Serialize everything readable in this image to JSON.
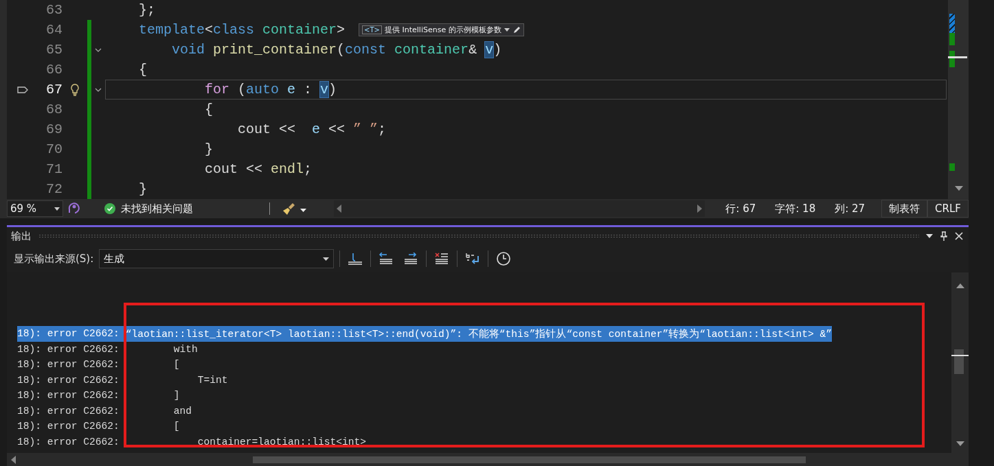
{
  "editor": {
    "lines": [
      {
        "number": "63",
        "current": false,
        "changed": false,
        "fold": false,
        "tokens": [
          {
            "text": "    };",
            "kind": "plain"
          }
        ]
      },
      {
        "number": "64",
        "current": false,
        "changed": true,
        "fold": false,
        "tokens": [
          {
            "text": "    template",
            "kind": "keyword"
          },
          {
            "text": "<",
            "kind": "plain"
          },
          {
            "text": "class",
            "kind": "keyword"
          },
          {
            "text": " container",
            "kind": "type"
          },
          {
            "text": ">",
            "kind": "plain"
          }
        ],
        "hint": {
          "badge": "<T>",
          "text": "提供 IntelliSense 的示例模板参数"
        }
      },
      {
        "number": "65",
        "current": false,
        "changed": true,
        "fold": true,
        "tokens": [
          {
            "text": "        void",
            "kind": "keyword"
          },
          {
            "text": " print_container",
            "kind": "function"
          },
          {
            "text": "(",
            "kind": "plain"
          },
          {
            "text": "const",
            "kind": "keyword"
          },
          {
            "text": " container",
            "kind": "type"
          },
          {
            "text": "& ",
            "kind": "plain"
          },
          {
            "text": "v",
            "kind": "highlight"
          },
          {
            "text": ")",
            "kind": "plain"
          }
        ]
      },
      {
        "number": "66",
        "current": false,
        "changed": true,
        "fold": false,
        "tokens": [
          {
            "text": "    {",
            "kind": "plain"
          }
        ]
      },
      {
        "number": "67",
        "current": true,
        "changed": true,
        "fold": true,
        "tokens": [
          {
            "text": "            for",
            "kind": "control"
          },
          {
            "text": " (",
            "kind": "plain"
          },
          {
            "text": "auto",
            "kind": "keyword"
          },
          {
            "text": " e",
            "kind": "variable"
          },
          {
            "text": " : ",
            "kind": "plain"
          },
          {
            "text": "v",
            "kind": "highlight"
          },
          {
            "text": ")",
            "kind": "plain"
          }
        ]
      },
      {
        "number": "68",
        "current": false,
        "changed": true,
        "fold": false,
        "tokens": [
          {
            "text": "            {",
            "kind": "plain"
          }
        ]
      },
      {
        "number": "69",
        "current": false,
        "changed": true,
        "fold": false,
        "tokens": [
          {
            "text": "                cout <<  ",
            "kind": "plain"
          },
          {
            "text": "e",
            "kind": "variable"
          },
          {
            "text": " << ",
            "kind": "plain"
          },
          {
            "text": "” ”",
            "kind": "string"
          },
          {
            "text": ";",
            "kind": "plain"
          }
        ]
      },
      {
        "number": "70",
        "current": false,
        "changed": true,
        "fold": false,
        "tokens": [
          {
            "text": "            }",
            "kind": "plain"
          }
        ]
      },
      {
        "number": "71",
        "current": false,
        "changed": true,
        "fold": false,
        "tokens": [
          {
            "text": "            cout << ",
            "kind": "plain"
          },
          {
            "text": "endl",
            "kind": "function"
          },
          {
            "text": ";",
            "kind": "plain"
          }
        ]
      },
      {
        "number": "72",
        "current": false,
        "changed": true,
        "fold": false,
        "tokens": [
          {
            "text": "    }",
            "kind": "plain"
          }
        ]
      }
    ]
  },
  "status_bar": {
    "zoom": "69 %",
    "issues": "未找到相关问题",
    "position": [
      "行: 67",
      "字符: 18",
      "列: 27"
    ],
    "indent": "制表符",
    "line_ending": "CRLF"
  },
  "output": {
    "title": "输出",
    "source_label": "显示输出来源(S):",
    "source": "生成",
    "rows": [
      {
        "prefix": "18): error C2662:",
        "message": "“laotian::list_iterator<T> laotian::list<T>::end(void)”: 不能将“this”指针从“const container”转换为“laotian::list<int> &”",
        "selected": true
      },
      {
        "prefix": "18): error C2662:",
        "message": "        with",
        "selected": false
      },
      {
        "prefix": "18): error C2662:",
        "message": "        [",
        "selected": false
      },
      {
        "prefix": "18): error C2662:",
        "message": "            T=int",
        "selected": false
      },
      {
        "prefix": "18): error C2662:",
        "message": "        ]",
        "selected": false
      },
      {
        "prefix": "18): error C2662:",
        "message": "        and",
        "selected": false
      },
      {
        "prefix": "18): error C2662:",
        "message": "        [",
        "selected": false
      },
      {
        "prefix": "18): error C2662:",
        "message": "            container=laotian::list<int>",
        "selected": false
      }
    ]
  }
}
